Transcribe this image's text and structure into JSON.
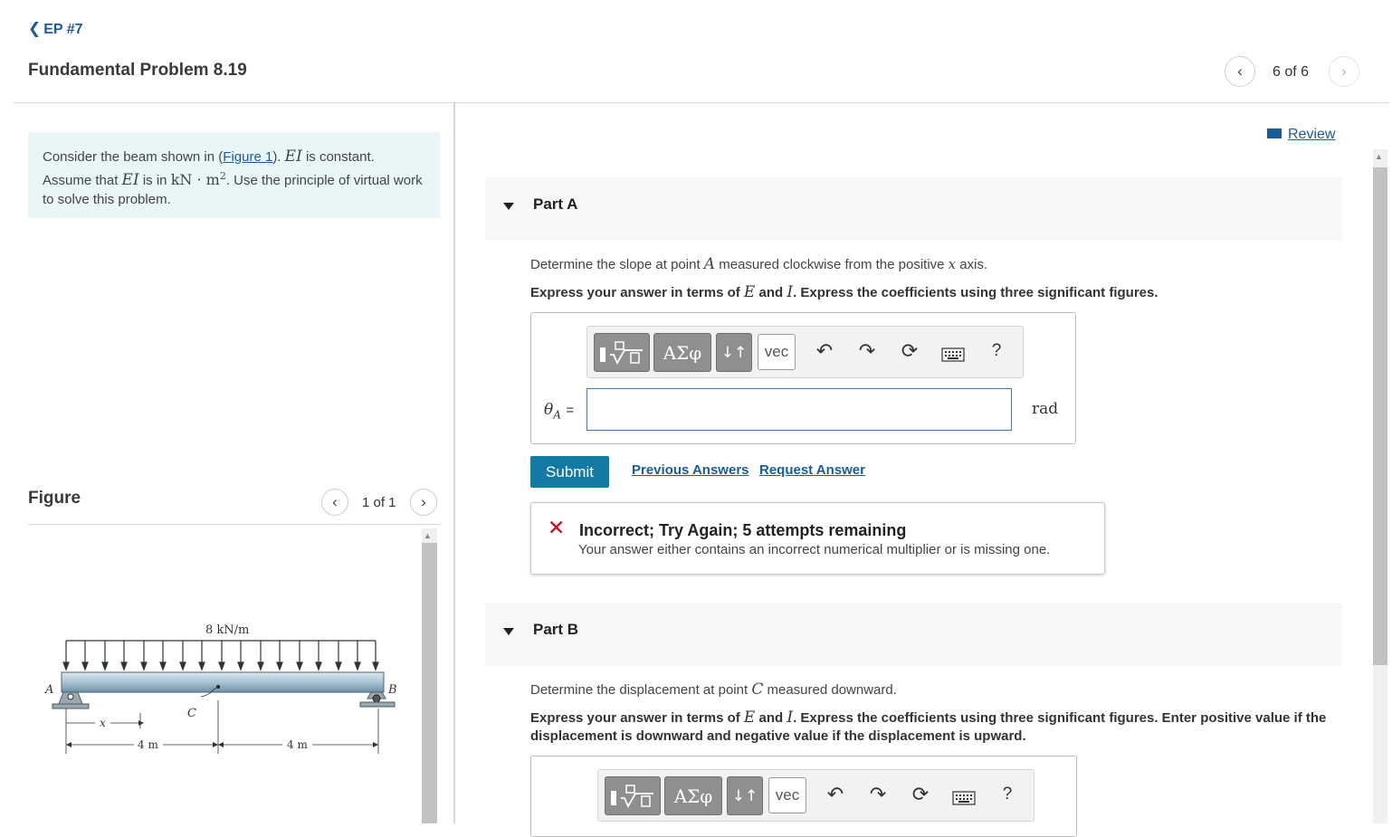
{
  "header": {
    "back_label": "EP #7",
    "title": "Fundamental Problem 8.19",
    "pager_text": "6 of 6"
  },
  "intro": {
    "part1": "Consider the beam shown in (",
    "figure_link": "Figure 1",
    "part2": "). ",
    "ei": "EI",
    "part3": " is constant. Assume that ",
    "part4": " is in ",
    "unit": "kN · m",
    "unit_exp": "2",
    "part5": ". Use the principle of virtual work to solve this problem."
  },
  "figure": {
    "label": "Figure",
    "pager_text": "1 of 1",
    "load_label": "8 kN/m",
    "point_a": "A",
    "point_b": "B",
    "point_c": "C",
    "x_label": "x",
    "dim_left": "4 m",
    "dim_right": "4 m"
  },
  "review": {
    "label": "Review"
  },
  "part_a": {
    "label": "Part A",
    "question_pre": "Determine the slope at point ",
    "question_point": "A",
    "question_post": " measured clockwise from the positive ",
    "question_axis": "x",
    "question_end": " axis.",
    "instr_pre": "Express your answer in terms of ",
    "instr_e": "E",
    "instr_and": " and ",
    "instr_i": "I",
    "instr_post": ". Express the coefficients using three significant figures.",
    "symbol": "θ",
    "symbol_sub": "A",
    "equals": "=",
    "unit": "rad",
    "input_value": "",
    "submit_label": "Submit",
    "previous_answers": "Previous Answers",
    "request_answer": "Request Answer"
  },
  "toolbar": {
    "greek": "ΑΣφ",
    "arrows": "↓↑",
    "vec": "vec",
    "help": "?"
  },
  "feedback": {
    "title": "Incorrect; Try Again; 5 attempts remaining",
    "message": "Your answer either contains an incorrect numerical multiplier or is missing one."
  },
  "part_b": {
    "label": "Part B",
    "question_pre": "Determine the displacement at point ",
    "question_point": "C",
    "question_post": " measured downward.",
    "instr_pre": "Express your answer in terms of ",
    "instr_e": "E",
    "instr_and": " and ",
    "instr_i": "I",
    "instr_post": ". Express the coefficients using three significant figures. Enter positive value if the displacement is downward and negative value if the displacement is upward."
  },
  "colors": {
    "link": "#1a5c9a",
    "submit": "#137aa6",
    "intro_bg": "#e8f6f7",
    "error": "#d0021b",
    "part_header_bg": "#f7f7f7"
  }
}
